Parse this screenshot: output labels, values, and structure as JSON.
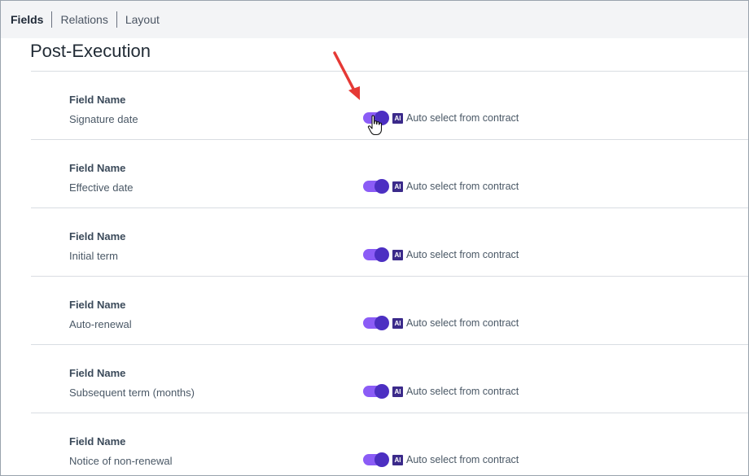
{
  "tabs": [
    {
      "label": "Fields",
      "active": true
    },
    {
      "label": "Relations",
      "active": false
    },
    {
      "label": "Layout",
      "active": false
    }
  ],
  "section": {
    "title": "Post-Execution"
  },
  "fields": [
    {
      "label": "Field Name",
      "value": "Signature date",
      "toggle_on": true,
      "ai_badge": "AI",
      "auto_label": "Auto select from contract"
    },
    {
      "label": "Field Name",
      "value": "Effective date",
      "toggle_on": true,
      "ai_badge": "AI",
      "auto_label": "Auto select from contract"
    },
    {
      "label": "Field Name",
      "value": "Initial term",
      "toggle_on": true,
      "ai_badge": "AI",
      "auto_label": "Auto select from contract"
    },
    {
      "label": "Field Name",
      "value": "Auto-renewal",
      "toggle_on": true,
      "ai_badge": "AI",
      "auto_label": "Auto select from contract"
    },
    {
      "label": "Field Name",
      "value": "Subsequent term (months)",
      "toggle_on": true,
      "ai_badge": "AI",
      "auto_label": "Auto select from contract"
    },
    {
      "label": "Field Name",
      "value": "Notice of non-renewal",
      "toggle_on": true,
      "ai_badge": "AI",
      "auto_label": "Auto select from contract"
    }
  ],
  "colors": {
    "toggle_track": "#8b5cf6",
    "toggle_knob": "#4c2fc2",
    "ai_badge": "#3b2a8a",
    "annotation_arrow": "#e53935"
  },
  "icons": {
    "annotation": "red-arrow-icon",
    "cursor": "hand-pointer-icon"
  }
}
